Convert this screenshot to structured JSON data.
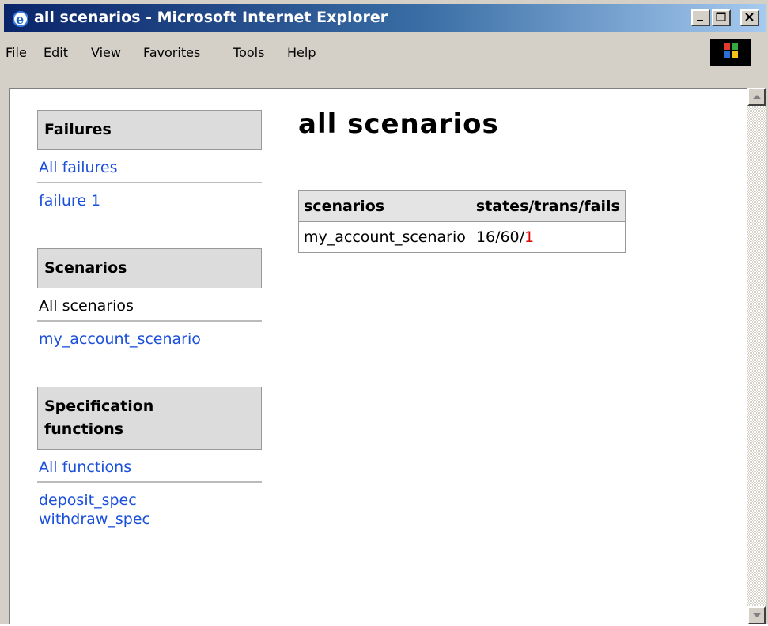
{
  "window": {
    "title": "all scenarios - Microsoft Internet Explorer"
  },
  "menu": {
    "items": [
      {
        "acc": "F",
        "rest": "ile"
      },
      {
        "acc": "E",
        "rest": "dit"
      },
      {
        "acc": "V",
        "rest": "iew"
      },
      {
        "pre": "F",
        "acc": "a",
        "rest": "vorites"
      },
      {
        "acc": "T",
        "rest": "ools"
      },
      {
        "acc": "H",
        "rest": "elp"
      }
    ]
  },
  "sidebar": {
    "failures": {
      "heading": "Failures",
      "all_link": "All failures",
      "items": [
        "failure 1"
      ]
    },
    "scenarios": {
      "heading": "Scenarios",
      "all_text": "All scenarios",
      "items": [
        "my_account_scenario"
      ]
    },
    "functions": {
      "heading_line1": "Specification",
      "heading_line2": "functions",
      "all_link": "All functions",
      "items": [
        "deposit_spec",
        "withdraw_spec"
      ]
    }
  },
  "main": {
    "title": "all scenarios",
    "table": {
      "headers": [
        "scenarios",
        "states/trans/fails"
      ],
      "rows": [
        {
          "name": "my_account_scenario",
          "counts": "16/60/",
          "fails": "1"
        }
      ]
    }
  }
}
